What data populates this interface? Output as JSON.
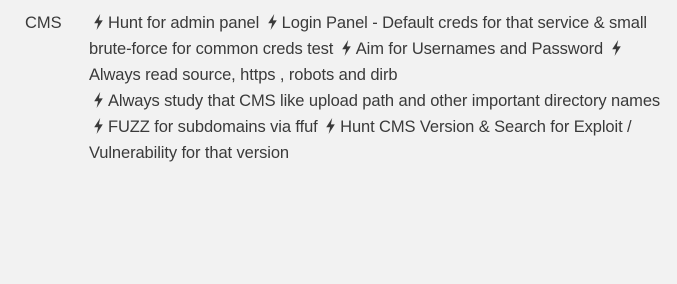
{
  "term": "CMS",
  "paragraphs": [
    {
      "segments": [
        "Hunt for admin panel",
        "Login Panel - Default creds for that service & small brute-force for common creds test",
        "Aim for Usernames and Password",
        "Always read source, https , robots and dirb"
      ]
    },
    {
      "segments": [
        "Always study that CMS like upload path and other important directory names"
      ]
    },
    {
      "segments": [
        "FUZZ for subdomains via ffuf",
        "Hunt CMS Version & Search for Exploit / Vulnerability for that version"
      ]
    }
  ],
  "icon": "lightning-bolt-icon",
  "colors": {
    "background": "#f2f2f2",
    "text": "#3a3a3a",
    "icon": "#3a3a3a"
  }
}
